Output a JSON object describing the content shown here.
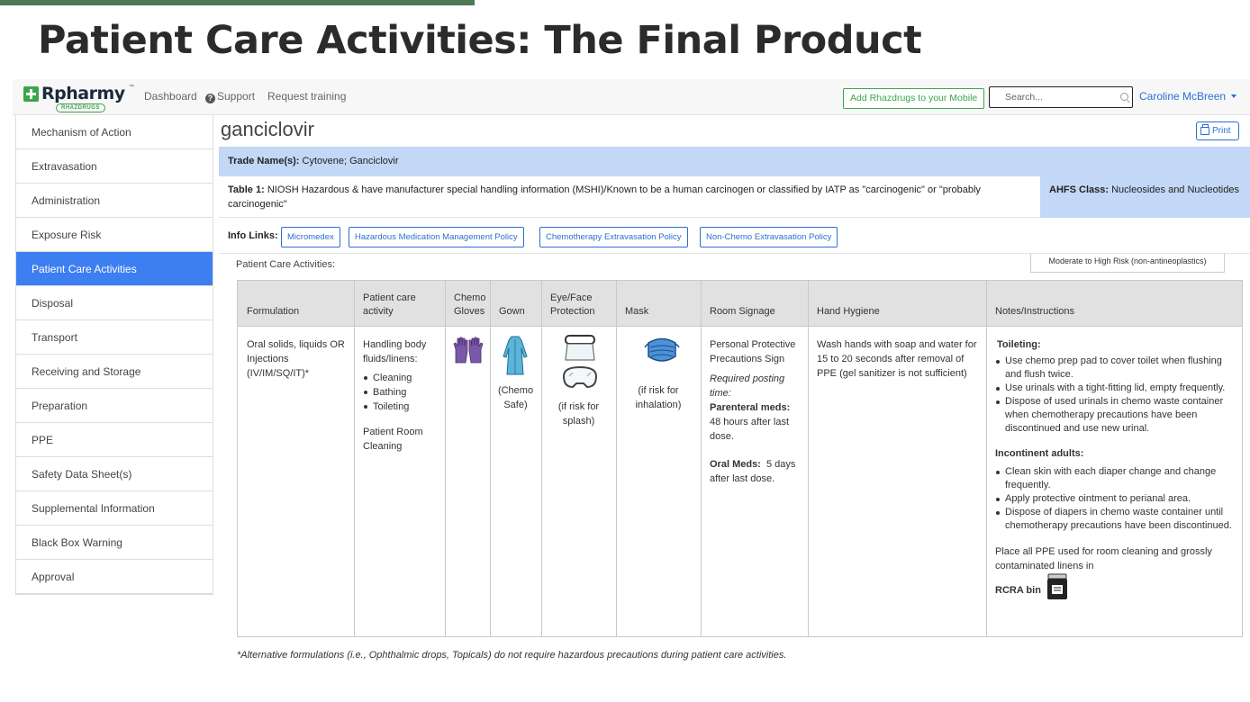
{
  "slide": {
    "title": "Patient Care Activities: The Final Product"
  },
  "navbar": {
    "logo_text": "Rpharmy",
    "logo_tm": "™",
    "logo_sub": "RHAZDRUGS",
    "links": [
      "Dashboard",
      "Support",
      "Request training"
    ],
    "mobile_button": "Add Rhazdrugs to your Mobile",
    "search_placeholder": "Search...",
    "user": "Caroline McBreen"
  },
  "sidebar": {
    "items": [
      "Mechanism of Action",
      "Extravasation",
      "Administration",
      "Exposure Risk",
      "Patient Care Activities",
      "Disposal",
      "Transport",
      "Receiving and Storage",
      "Preparation",
      "PPE",
      "Safety Data Sheet(s)",
      "Supplemental Information",
      "Black Box Warning",
      "Approval"
    ],
    "active_index": 4
  },
  "drug": {
    "name": "ganciclovir",
    "print_label": "Print",
    "trade_label": "Trade Name(s):",
    "trade_value": "Cytovene; Ganciclovir",
    "table1_label": "Table 1:",
    "table1_value": "NIOSH Hazardous & have manufacturer special handling information (MSHI)/Known to be a human carcinogen or classified by IATP as \"carcinogenic\" or \"probably carcinogenic\"",
    "ahfs_label": "AHFS Class:",
    "ahfs_value": "Nucleosides and Nucleotides"
  },
  "info_links": {
    "label": "Info Links:",
    "links": [
      "Micromedex",
      "Hazardous Medication Management Policy",
      "Chemotherapy Extravasation Policy",
      "Non-Chemo Extravasation Policy"
    ]
  },
  "pca": {
    "label": "Patient Care Activities:",
    "risk": "Moderate to High Risk (non-antineoplastics)",
    "headers": [
      "Formulation",
      "Patient care activity",
      "Chemo Gloves",
      "Gown",
      "Eye/Face Protection",
      "Mask",
      "Room Signage",
      "Hand Hygiene",
      "Notes/Instructions"
    ],
    "formulation": "Oral solids, liquids OR Injections (IV/IM/SQ/IT)*",
    "activity": {
      "intro": "Handling body fluids/linens:",
      "items": [
        "Cleaning",
        "Bathing",
        "Toileting"
      ],
      "room": "Patient Room Cleaning"
    },
    "gown_note": "(Chemo Safe)",
    "eye_note": "(if risk for splash)",
    "mask_note": "(if risk for inhalation)",
    "signage": {
      "sign": "Personal Protective Precautions Sign",
      "posting": "Required posting time:",
      "parenteral_label": "Parenteral meds:",
      "parenteral_value": "48 hours after last dose.",
      "oral_label": "Oral Meds:",
      "oral_value": "5 days after last dose."
    },
    "hygiene": "Wash hands with soap and water for 15 to 20 seconds after removal of PPE (gel sanitizer is not sufficient)",
    "notes": {
      "toileting_heading": "Toileting:",
      "toileting": [
        "Use chemo prep pad to cover toilet when flushing and flush twice.",
        "Use urinals with a tight-fitting lid, empty frequently.",
        "Dispose of used urinals in chemo waste container when chemotherapy precautions have been discontinued and use new urinal."
      ],
      "incontinent_heading": "Incontinent adults:",
      "incontinent": [
        "Clean skin with each diaper change and change frequently.",
        "Apply protective ointment to perianal area.",
        "Dispose of diapers in chemo waste container until chemotherapy precautions have been discontinued."
      ],
      "ppe_text": "Place all PPE used for room cleaning and grossly contaminated linens in",
      "ppe_bold": "RCRA bin"
    },
    "footnote": "*Alternative formulations (i.e., Ophthalmic drops, Topicals) do not require hazardous precautions during patient care activities."
  }
}
